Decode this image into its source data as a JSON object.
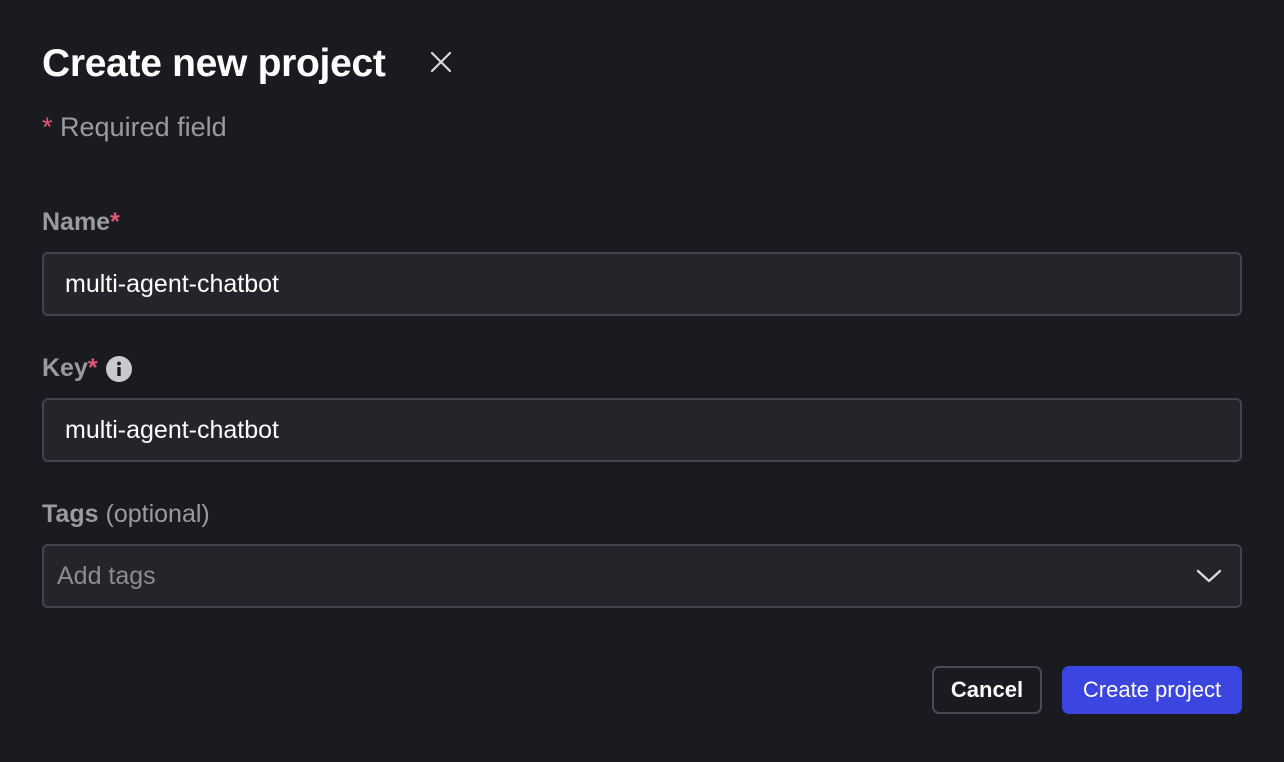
{
  "dialog": {
    "title": "Create new project",
    "close_icon": "close-icon",
    "required_note": {
      "asterisk": "*",
      "text": "Required field"
    }
  },
  "fields": {
    "name": {
      "label": "Name",
      "required_mark": "*",
      "value": "multi-agent-chatbot"
    },
    "key": {
      "label": "Key",
      "required_mark": "*",
      "info_icon": "info-icon",
      "value": "multi-agent-chatbot"
    },
    "tags": {
      "label": "Tags",
      "optional_text": "(optional)",
      "placeholder": "Add tags",
      "dropdown_icon": "chevron-down-icon"
    }
  },
  "actions": {
    "cancel_label": "Cancel",
    "create_label": "Create project"
  },
  "colors": {
    "background": "#1a1b20",
    "input_background": "#24252b",
    "input_border": "#43444b",
    "required_asterisk": "#e0577a",
    "primary_button": "#3b45df",
    "muted_text": "#9a9ba1"
  }
}
